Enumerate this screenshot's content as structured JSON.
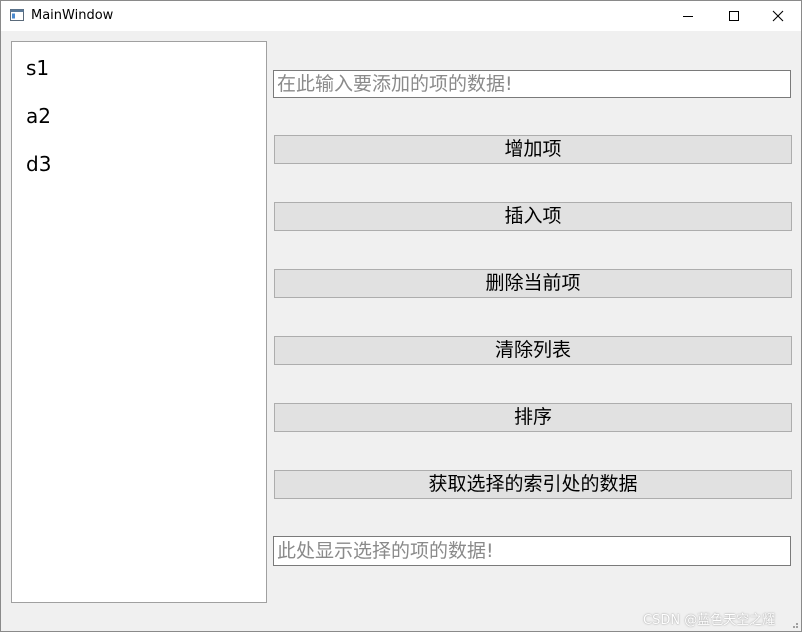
{
  "window": {
    "title": "MainWindow",
    "icons": {
      "app": "app-window-icon",
      "minimize": "minimize-icon",
      "maximize": "maximize-icon",
      "close": "close-icon"
    }
  },
  "list": {
    "items": [
      "s1",
      "a2",
      "d3"
    ]
  },
  "input": {
    "placeholder": "在此输入要添加的项的数据!",
    "value": ""
  },
  "buttons": {
    "add": "增加项",
    "insert": "插入项",
    "delete_current": "删除当前项",
    "clear": "清除列表",
    "sort": "排序",
    "get_selected": "获取选择的索引处的数据"
  },
  "output": {
    "placeholder": "此处显示选择的项的数据!",
    "value": ""
  },
  "watermark": "CSDN @蓝色天空之耀"
}
